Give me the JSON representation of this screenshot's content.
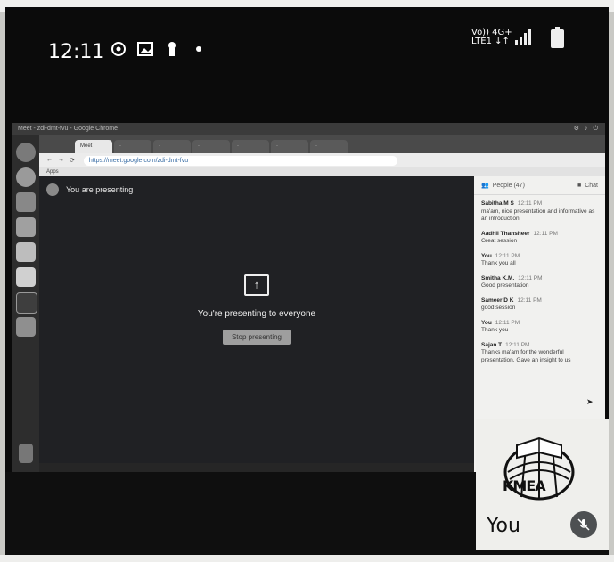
{
  "status_bar": {
    "time": "12:11",
    "network_line1": "Vo)) 4G+",
    "network_line2": "LTE1 ↓↑",
    "icons": [
      "whatsapp-icon",
      "gallery-icon",
      "keyhole-icon",
      "dot-icon"
    ]
  },
  "chrome": {
    "window_title": "Meet - zdi-dmt-fvu - Google Chrome",
    "url": "https://meet.google.com/zdi-dmt-fvu",
    "apps_label": "Apps"
  },
  "meet": {
    "presenting_banner": "You are presenting",
    "presenting_message": "You're presenting to everyone",
    "stop_button": "Stop presenting"
  },
  "panel": {
    "tab_people": "People (47)",
    "tab_chat": "Chat",
    "messages": [
      {
        "name": "Sabitha M S",
        "time": "12:11 PM",
        "text": "ma'am, nice presentation and informative as an introduction"
      },
      {
        "name": "Aadhil Thansheer",
        "time": "12:11 PM",
        "text": "Great session"
      },
      {
        "name": "You",
        "time": "12:11 PM",
        "text": "Thank you all"
      },
      {
        "name": "Smitha K.M.",
        "time": "12:11 PM",
        "text": "Good presentation"
      },
      {
        "name": "Sameer D K",
        "time": "12:11 PM",
        "text": "good session"
      },
      {
        "name": "You",
        "time": "12:11 PM",
        "text": "Thank you"
      },
      {
        "name": "Sajan T",
        "time": "12:11 PM",
        "text": "Thanks ma'am for the wonderful presentation. Gave an insight to us"
      }
    ]
  },
  "tile": {
    "logo_text": "KMEA",
    "label": "You"
  }
}
